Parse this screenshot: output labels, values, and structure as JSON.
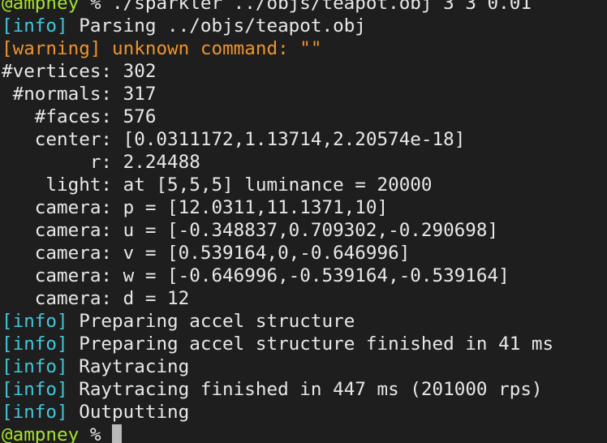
{
  "terminal": {
    "prompt_host": "@ampney",
    "prompt_sep": " % ",
    "command": "./sparkler ../objs/teapot.obj 3 3 0.01",
    "tag_info": "[info]",
    "tag_warning": "[warning]",
    "parse_msg": " Parsing ../objs/teapot.obj",
    "warning_msg": " unknown command: \"\"",
    "stats": [
      "#vertices: 302",
      " #normals: 317",
      "   #faces: 576",
      "   center: [0.0311172,1.13714,2.20574e-18]",
      "        r: 2.24488",
      "    light: at [5,5,5] luminance = 20000",
      "   camera: p = [12.0311,11.1371,10]",
      "   camera: u = [-0.348837,0.709302,-0.290698]",
      "   camera: v = [0.539164,0,-0.646996]",
      "   camera: w = [-0.646996,-0.539164,-0.539164]",
      "   camera: d = 12"
    ],
    "info_msgs": [
      " Preparing accel structure",
      " Preparing accel structure finished in 41 ms",
      " Raytracing",
      " Raytracing finished in 447 ms (201000 rps)",
      " Outputting"
    ],
    "final_prompt_host": "@ampney",
    "final_prompt_sep": " % ",
    "colors": {
      "background": "#1e1e1e",
      "text": "#e8e8e8",
      "host": "#a6e22e",
      "info": "#43c6d8",
      "warning": "#f0932b",
      "cursor": "#b9b9b9"
    }
  }
}
